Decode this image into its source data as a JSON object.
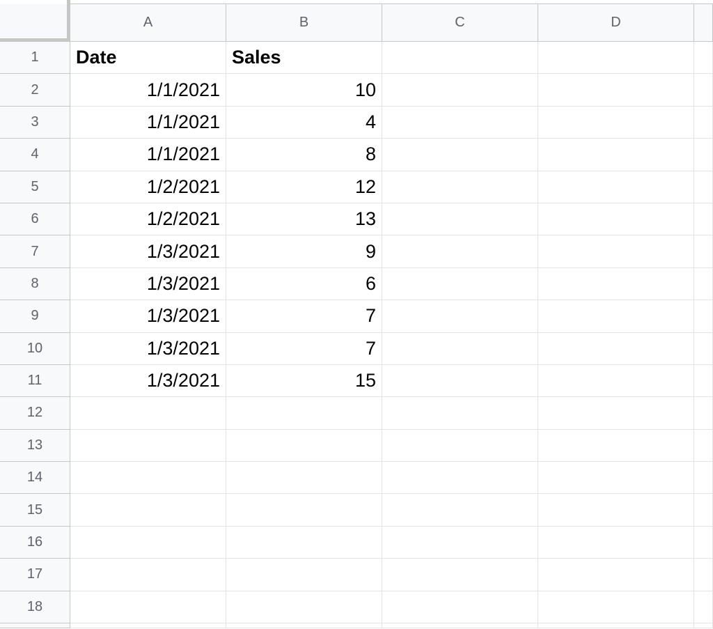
{
  "columns": [
    "A",
    "B",
    "C",
    "D",
    ""
  ],
  "rows": [
    {
      "n": "1",
      "a": "Date",
      "b": "Sales",
      "header": true
    },
    {
      "n": "2",
      "a": "1/1/2021",
      "b": "10"
    },
    {
      "n": "3",
      "a": "1/1/2021",
      "b": "4"
    },
    {
      "n": "4",
      "a": "1/1/2021",
      "b": "8"
    },
    {
      "n": "5",
      "a": "1/2/2021",
      "b": "12"
    },
    {
      "n": "6",
      "a": "1/2/2021",
      "b": "13"
    },
    {
      "n": "7",
      "a": "1/3/2021",
      "b": "9"
    },
    {
      "n": "8",
      "a": "1/3/2021",
      "b": "6"
    },
    {
      "n": "9",
      "a": "1/3/2021",
      "b": "7"
    },
    {
      "n": "10",
      "a": "1/3/2021",
      "b": "7"
    },
    {
      "n": "11",
      "a": "1/3/2021",
      "b": "15"
    },
    {
      "n": "12",
      "a": "",
      "b": ""
    },
    {
      "n": "13",
      "a": "",
      "b": ""
    },
    {
      "n": "14",
      "a": "",
      "b": ""
    },
    {
      "n": "15",
      "a": "",
      "b": ""
    },
    {
      "n": "16",
      "a": "",
      "b": ""
    },
    {
      "n": "17",
      "a": "",
      "b": ""
    },
    {
      "n": "18",
      "a": "",
      "b": ""
    }
  ],
  "colors": {
    "header_bg": "#f8f9fa",
    "header_text": "#5f6368",
    "gridline": "#e2e3e3",
    "header_border": "#c4c7c5"
  }
}
